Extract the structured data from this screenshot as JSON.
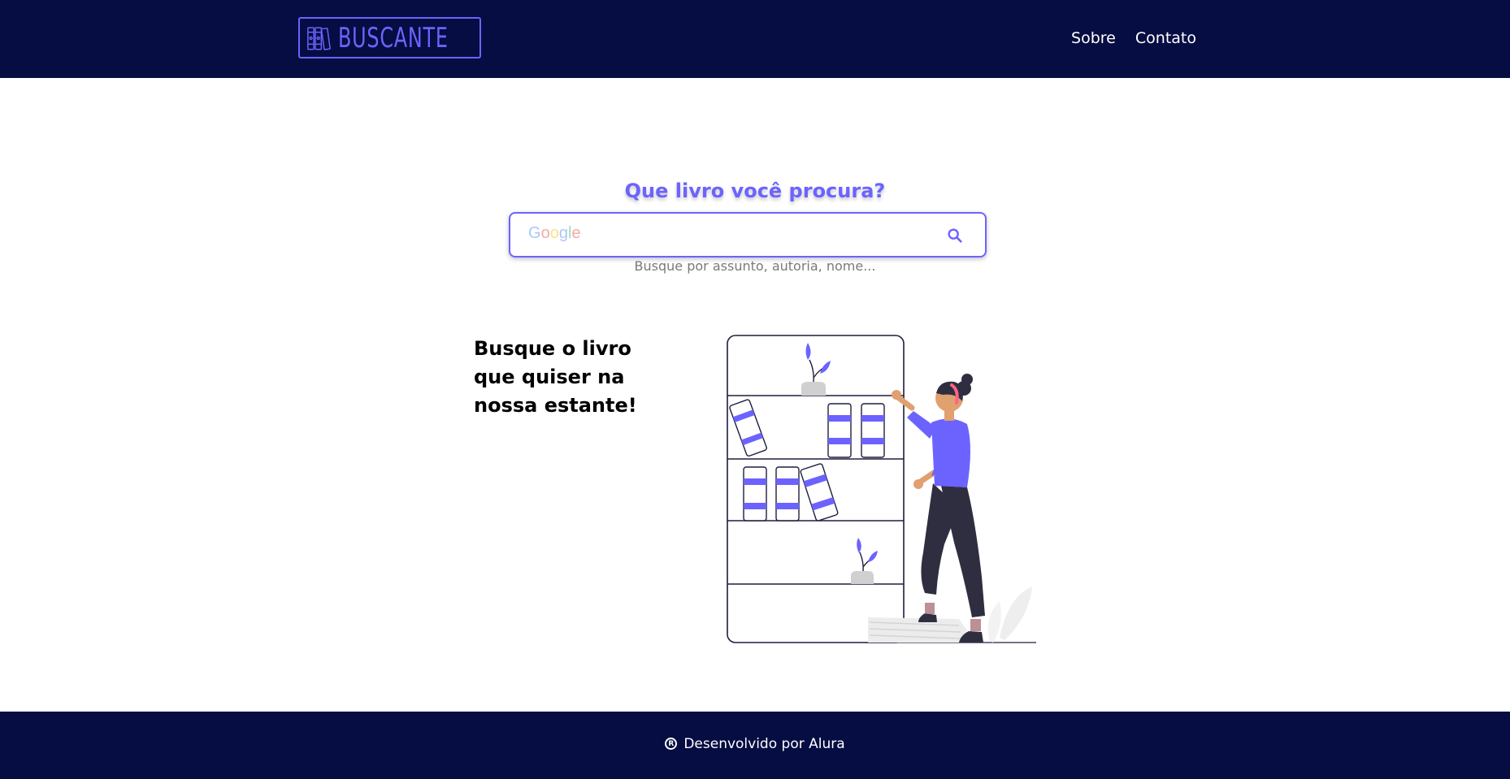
{
  "header": {
    "logo_text": "BUSCANTE",
    "nav": [
      {
        "label": "Sobre"
      },
      {
        "label": "Contato"
      }
    ]
  },
  "search": {
    "title": "Que livro você procura?",
    "input_value": "",
    "google_watermark": "Google",
    "hint": "Busque por assunto, autoria, nome..."
  },
  "hero": {
    "tagline_lines": [
      "Busque o livro",
      "que quiser na",
      "nossa estante!"
    ]
  },
  "footer": {
    "text": "Desenvolvido por Alura"
  },
  "colors": {
    "navy": "#050d42",
    "accent": "#6c63ff",
    "hint": "#7a7a7a"
  },
  "icons": {
    "logo": "books-icon",
    "search": "search-icon",
    "footer": "registered-icon"
  }
}
